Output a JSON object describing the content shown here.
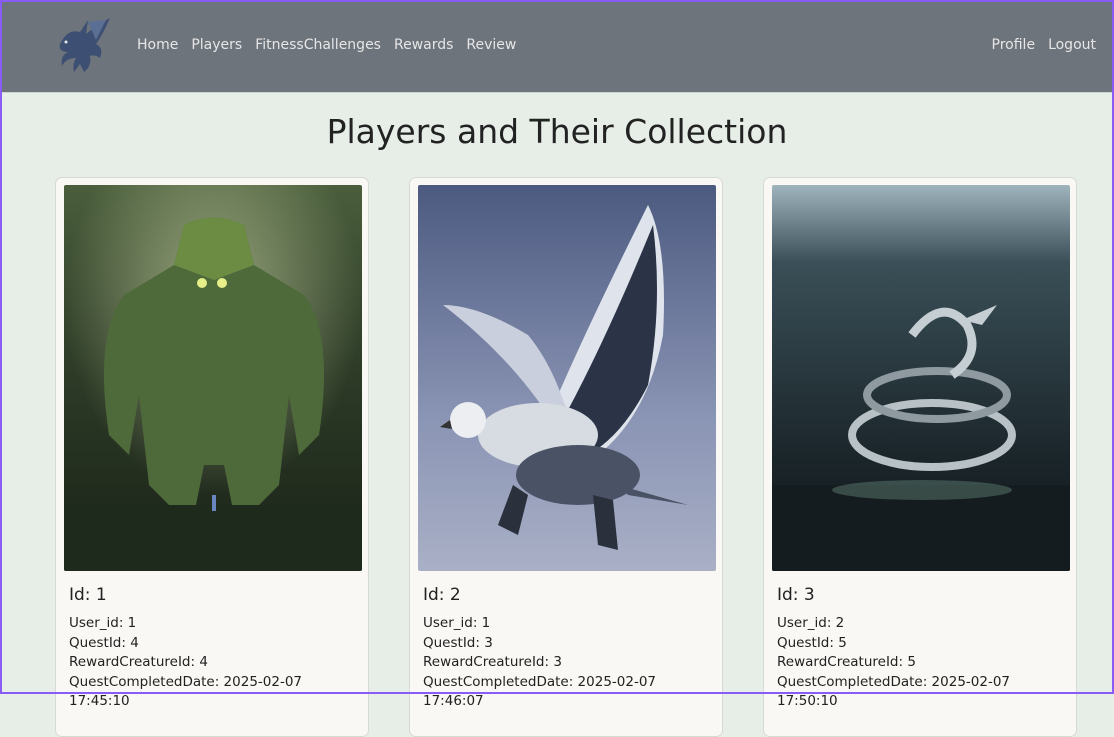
{
  "nav": {
    "links": [
      "Home",
      "Players",
      "FitnessChallenges",
      "Rewards",
      "Review"
    ],
    "right_links": [
      "Profile",
      "Logout"
    ]
  },
  "page_title": "Players and Their Collection",
  "cards": [
    {
      "id_label": "Id: 1",
      "user_id": "User_id: 1",
      "quest_id": "QuestId: 4",
      "reward_creature_id": "RewardCreatureId: 4",
      "quest_completed_date": "QuestCompletedDate: 2025-02-07",
      "quest_completed_time": "17:45:10",
      "image": "forest-golem-image"
    },
    {
      "id_label": "Id: 2",
      "user_id": "User_id: 1",
      "quest_id": "QuestId: 3",
      "reward_creature_id": "RewardCreatureId: 3",
      "quest_completed_date": "QuestCompletedDate: 2025-02-07",
      "quest_completed_time": "17:46:07",
      "image": "griffin-image"
    },
    {
      "id_label": "Id: 3",
      "user_id": "User_id: 2",
      "quest_id": "QuestId: 5",
      "reward_creature_id": "RewardCreatureId: 5",
      "quest_completed_date": "QuestCompletedDate: 2025-02-07",
      "quest_completed_time": "17:50:10",
      "image": "sea-serpent-image"
    }
  ],
  "colors": {
    "navbar": "#6e747c",
    "background": "#e6eee7",
    "card": "#faf8f4"
  }
}
